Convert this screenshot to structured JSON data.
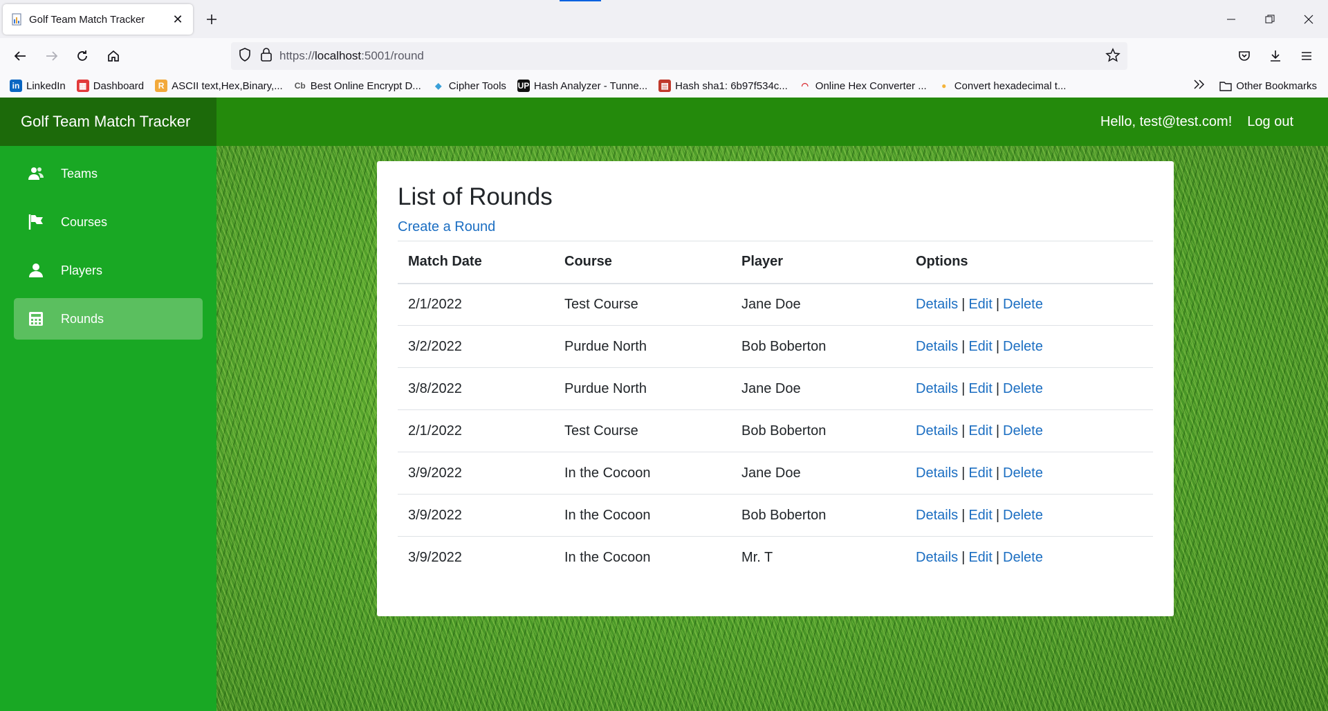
{
  "browser": {
    "tab_title": "Golf Team Match Tracker",
    "url_scheme": "https://",
    "url_host": "localhost",
    "url_path": ":5001/round",
    "bookmarks": [
      {
        "label": "LinkedIn",
        "icon": "linkedin-icon",
        "color": "#0a66c2"
      },
      {
        "label": "Dashboard",
        "icon": "dashboard-icon",
        "color": "#e23a3a"
      },
      {
        "label": "ASCII text,Hex,Binary,...",
        "icon": "r-icon",
        "color": "#f2a93b"
      },
      {
        "label": "Best Online Encrypt D...",
        "icon": "cb-icon",
        "color": "#555555"
      },
      {
        "label": "Cipher Tools",
        "icon": "cipher-icon",
        "color": "#3aa0d8"
      },
      {
        "label": "Hash Analyzer - Tunne...",
        "icon": "up-icon",
        "color": "#111111"
      },
      {
        "label": "Hash sha1: 6b97f534c...",
        "icon": "hash-icon",
        "color": "#c0392b"
      },
      {
        "label": "Online Hex Converter ...",
        "icon": "wifi-icon",
        "color": "#d9262c"
      },
      {
        "label": "Convert hexadecimal t...",
        "icon": "convert-icon",
        "color": "#f4b43b"
      }
    ],
    "other_bookmarks": "Other Bookmarks"
  },
  "app": {
    "brand": "Golf Team Match Tracker",
    "greeting": "Hello, test@test.com!",
    "logout": "Log out"
  },
  "sidebar": {
    "items": [
      {
        "label": "Teams",
        "icon": "teams-icon",
        "active": false
      },
      {
        "label": "Courses",
        "icon": "flag-icon",
        "active": false
      },
      {
        "label": "Players",
        "icon": "player-icon",
        "active": false
      },
      {
        "label": "Rounds",
        "icon": "calculator-icon",
        "active": true
      }
    ]
  },
  "main": {
    "title": "List of Rounds",
    "create_link": "Create a Round",
    "columns": [
      "Match Date",
      "Course",
      "Player",
      "Options"
    ],
    "option_labels": {
      "details": "Details",
      "edit": "Edit",
      "delete": "Delete",
      "sep": "|"
    },
    "rows": [
      {
        "date": "2/1/2022",
        "course": "Test Course",
        "player": "Jane Doe"
      },
      {
        "date": "3/2/2022",
        "course": "Purdue North",
        "player": "Bob Boberton"
      },
      {
        "date": "3/8/2022",
        "course": "Purdue North",
        "player": "Jane Doe"
      },
      {
        "date": "2/1/2022",
        "course": "Test Course",
        "player": "Bob Boberton"
      },
      {
        "date": "3/9/2022",
        "course": "In the Cocoon",
        "player": "Jane Doe"
      },
      {
        "date": "3/9/2022",
        "course": "In the Cocoon",
        "player": "Bob Boberton"
      },
      {
        "date": "3/9/2022",
        "course": "In the Cocoon",
        "player": "Mr. T"
      }
    ]
  },
  "colors": {
    "topbar": "#248a0c",
    "brand_bg": "#1c6a0a",
    "sidebar": "#19a824",
    "active_item": "#5bbf5f",
    "link": "#1b6ec2"
  }
}
